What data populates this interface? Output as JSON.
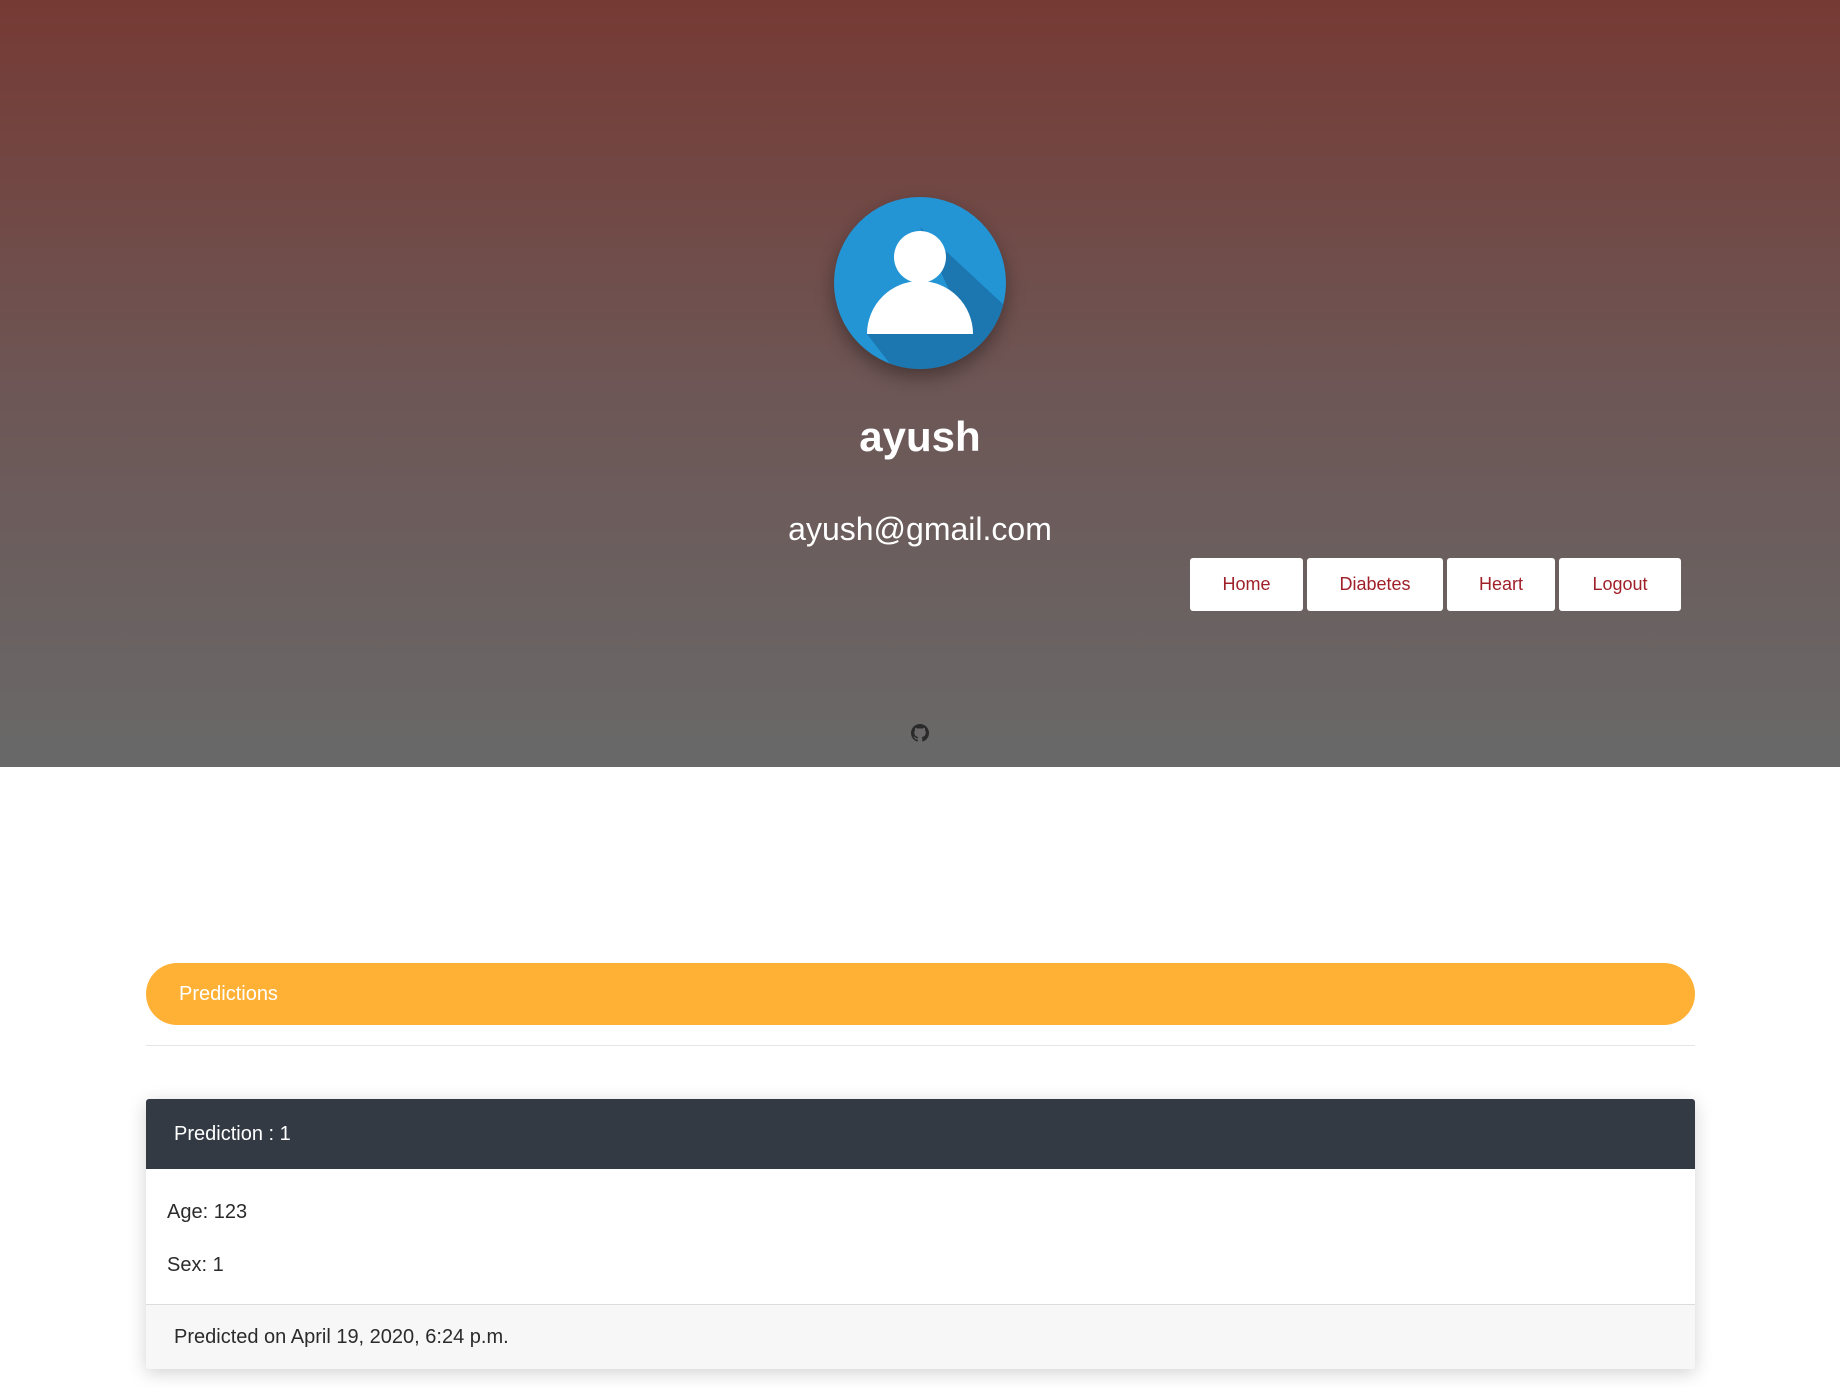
{
  "profile": {
    "name": "ayush",
    "email": "ayush@gmail.com",
    "avatar_icon": "user-avatar-icon"
  },
  "nav": {
    "home": "Home",
    "diabetes": "Diabetes",
    "heart": "Heart",
    "logout": "Logout"
  },
  "social": {
    "github_icon": "github-icon"
  },
  "predictions": {
    "heading": "Predictions",
    "items": [
      {
        "title": "Prediction : 1",
        "age": "Age: 123",
        "sex": "Sex: 1",
        "footer": "Predicted on April 19, 2020, 6:24 p.m."
      }
    ]
  },
  "colors": {
    "hero_top": "#763a34",
    "hero_bottom": "#696969",
    "accent_bar": "#ffb136",
    "nav_text": "#a0202a",
    "card_header": "#343a44",
    "avatar_bg": "#2395d5"
  }
}
